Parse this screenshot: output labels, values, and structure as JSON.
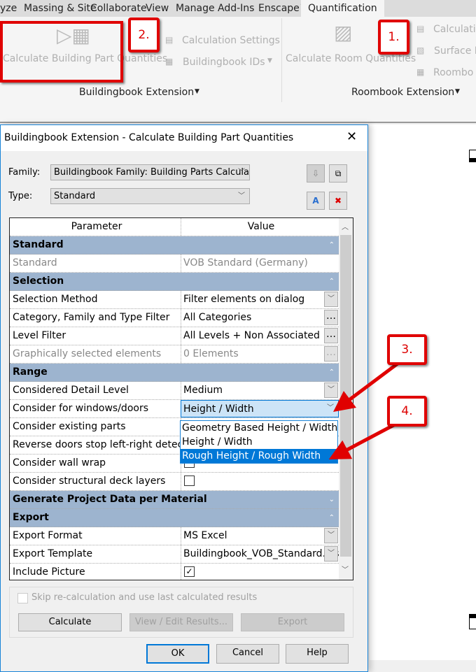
{
  "ribbon": {
    "tabs": [
      "yze",
      "Massing & Site",
      "Collaborate",
      "View",
      "Manage",
      "Add-Ins",
      "Enscape™",
      "Quantification"
    ],
    "active_tab": "Quantification",
    "buildingbook": {
      "calc_parts": "Calculate Building Part Quantities",
      "calc_settings": "Calculation Settings",
      "ids": "Buildingbook IDs",
      "panel": "Buildingbook Extension"
    },
    "roombook": {
      "calc_rooms": "Calculate Room Quantities",
      "calc": "Calculatio",
      "surface": "Surface M",
      "roombook": "Roombo",
      "panel": "Roombook Extension"
    }
  },
  "callouts": [
    "1.",
    "2.",
    "3.",
    "4."
  ],
  "dialog": {
    "title": "Buildingbook Extension - Calculate Building Part Quantities",
    "family_label": "Family:",
    "family_value": "Buildingbook Family: Building Parts Calculatio",
    "type_label": "Type:",
    "type_value": "Standard",
    "grid": {
      "col_param": "Parameter",
      "col_value": "Value",
      "rows": [
        {
          "kind": "sec",
          "p": "Standard"
        },
        {
          "kind": "grey",
          "p": "Standard",
          "v": "VOB Standard (Germany)"
        },
        {
          "kind": "sec",
          "p": "Selection"
        },
        {
          "p": "Selection Method",
          "v": "Filter elements on dialog",
          "ctl": "dd"
        },
        {
          "p": "Category, Family and Type Filter",
          "v": "All Categories",
          "ctl": "ell"
        },
        {
          "p": "Level Filter",
          "v": "All Levels + Non Associated",
          "ctl": "ell"
        },
        {
          "kind": "grey",
          "p": "Graphically selected elements",
          "v": "0 Elements",
          "ctl": "ell"
        },
        {
          "kind": "sec",
          "p": "Range"
        },
        {
          "p": "Considered Detail Level",
          "v": "Medium",
          "ctl": "dd"
        },
        {
          "kind": "active",
          "p": "Consider for windows/doors",
          "v": "Height / Width",
          "ctl": "dd"
        },
        {
          "p": "Consider existing parts",
          "v": ""
        },
        {
          "p": "Reverse doors stop left-right detection",
          "v": ""
        },
        {
          "p": "Consider wall wrap",
          "v": "",
          "ctl": "cb"
        },
        {
          "p": "Consider structural deck layers",
          "v": "",
          "ctl": "cb"
        },
        {
          "kind": "sec",
          "p": "Generate Project Data per Material",
          "collapsed": true
        },
        {
          "kind": "sec",
          "p": "Export"
        },
        {
          "p": "Export Format",
          "v": "MS Excel",
          "ctl": "dd"
        },
        {
          "p": "Export Template",
          "v": "Buildingbook_VOB_Standard.xlsx",
          "ctl": "dd"
        },
        {
          "p": "Include Picture",
          "v": "",
          "ctl": "cbchk"
        }
      ],
      "dropdown_options": [
        "Geometry Based Height / Width",
        "Height / Width",
        "Rough Height / Rough Width"
      ],
      "dropdown_highlighted": "Rough Height / Rough Width"
    },
    "skip_label": "Skip re-calculation and use last calculated results",
    "calculate": "Calculate",
    "view_edit": "View / Edit Results...",
    "export": "Export",
    "ok": "OK",
    "cancel": "Cancel",
    "help": "Help"
  }
}
